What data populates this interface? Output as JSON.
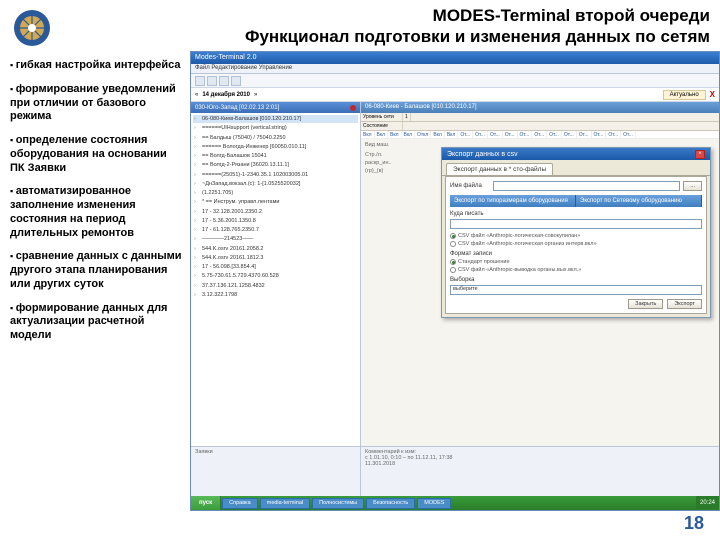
{
  "slide": {
    "title_line1": "MODES-Terminal второй очереди",
    "title_line2": "Функционал подготовки и изменения данных по сетям",
    "page_number": "18"
  },
  "bullets": [
    "гибкая настройка интерфейса",
    "формирование уведомлений при отличии от базового режима",
    "определение состояния оборудования на основании ПК Заявки",
    "автоматизированное заполнение изменения состояния на период длительных ремонтов",
    "сравнение данных с данными другого этапа планирования или других суток",
    "формирование данных для актуализации расчетной модели"
  ],
  "app": {
    "window_title": "Modes-Terminal 2.0",
    "menubar": "Файл  Редактирование  Управление",
    "date_nav": "14 декабря 2010",
    "tab_label": "Актуально",
    "close_x": "X",
    "left_header": "030-Юго-Запад [02.02.13 2:01]",
    "right_header": "06-080-Киев - Балашов [010.120.210.17]",
    "grid_label": "Уровень сети",
    "grid_state": "Состояние",
    "grid_cols": [
      "Вкл",
      "Вкл",
      "Вкл",
      "Вкл",
      "Откл",
      "Вкл",
      "Вкл",
      "От...",
      "От...",
      "От...",
      "От...",
      "От...",
      "От...",
      "От...",
      "От...",
      "От...",
      "От...",
      "От...",
      "От..."
    ],
    "tree_items": [
      "06-080-Киев-Балашов [010.120.210.17]",
      "======UIHsupport (vertical.string)",
      "== Балдыш (75040) / 75040.2250",
      "====== Вологда-Инженер [60050.010.11]",
      "== Волгд-Балашов 15041",
      "== Волгд-2-Рязани [36020.13.11.1]",
      "======(25051)-1-2340.35.1 102003005.01",
      "~ДнЗапад.вокзал.(с): 1-[1.0525520032]",
      "(1.2251.705)",
      "* == Инструм. управл.лентами",
      "17 - 32.128.2001.2350.2",
      "17 - 5.36.2001.1350.8",
      "17 - 61.128.765.2350.7",
      "————214523——",
      "544.K.osrv 20161.2058.2",
      "544.K.osrv 20161.1812.3",
      "17 - 56.098.[33.854.4]",
      "5.75-730.61.5.729.4370.60.528",
      "37.37.136.121.1258.4832",
      "3.12.322.1798"
    ],
    "selected_index": 0,
    "dialog": {
      "title": "Экспорт данных в csv",
      "tab1": "Экспорт данных в * сто-файлы",
      "filename_label": "Имя файла",
      "filename_value": "",
      "browse_btn": "...",
      "blue_tab1": "Экспорт по типоразмерам оборудования",
      "blue_tab2": "Экспорт по Сетевому оборудованию",
      "where_label": "Куда писать",
      "radio1_label": "CSV файл «Anthropic-логическая-совокупилан»",
      "radio2_label": "CSV файл «Anthropic-логическая организ интерв.вкл»",
      "format_label": "Формат записи",
      "radio3_label": "Стандарт прошение",
      "radio4_label": "CSV файл «Anthropic-выводка органы.вых.вкл.»",
      "group_label": "Выборка",
      "selection_field": "выберите",
      "btn_cancel": "Закрыть",
      "btn_export": "Экспорт"
    },
    "bottom": {
      "left_label": "Заявки",
      "period": "с 1.01.10, 0:10 – по 11.12.11, 17:38",
      "comment_label": "Комментарий к изм:",
      "comment_value": "11.301.2018"
    },
    "taskbar": {
      "start": "пуск",
      "items": [
        "Справка",
        "media-terminal",
        "Полносистемы",
        "Безопасность",
        "MODES"
      ],
      "time": "20:24"
    }
  }
}
